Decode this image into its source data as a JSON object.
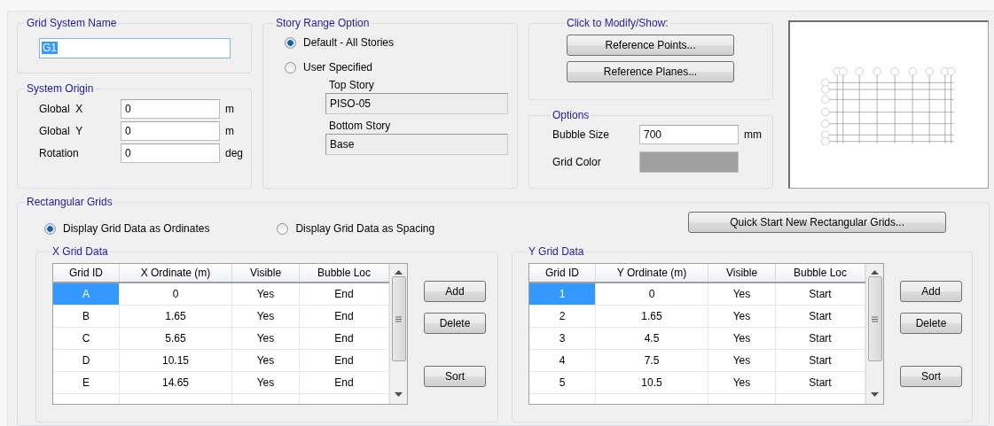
{
  "grid_system_name": {
    "title": "Grid System Name",
    "value": "G1"
  },
  "system_origin": {
    "title": "System Origin",
    "fields": [
      {
        "label": "Global  X",
        "value": "0",
        "unit": "m"
      },
      {
        "label": "Global  Y",
        "value": "0",
        "unit": "m"
      },
      {
        "label": "Rotation",
        "value": "0",
        "unit": "deg"
      }
    ]
  },
  "story_range_option": {
    "title": "Story Range Option",
    "options": [
      {
        "label": "Default - All Stories",
        "selected": true
      },
      {
        "label": "User Specified",
        "selected": false
      }
    ],
    "top_story": {
      "label": "Top Story",
      "value": "PISO-05"
    },
    "bottom_story": {
      "label": "Bottom Story",
      "value": "Base"
    }
  },
  "click_to_modify": {
    "title": "Click to Modify/Show:",
    "buttons": [
      "Reference Points...",
      "Reference Planes..."
    ]
  },
  "options": {
    "title": "Options",
    "bubble_size": {
      "label": "Bubble Size",
      "value": "700",
      "unit": "mm"
    },
    "grid_color": {
      "label": "Grid Color",
      "color": "#a0a0a0"
    }
  },
  "rectangular_grids": {
    "title": "Rectangular Grids",
    "display_options": [
      {
        "label": "Display Grid Data as Ordinates",
        "selected": true
      },
      {
        "label": "Display Grid Data as Spacing",
        "selected": false
      }
    ],
    "quick_start_button": "Quick Start New Rectangular Grids...",
    "grids": [
      {
        "title": "X Grid Data",
        "columns": [
          "Grid ID",
          "X Ordinate (m)",
          "Visible",
          "Bubble Loc"
        ],
        "rows": [
          {
            "cells": [
              "A",
              "0",
              "Yes",
              "End"
            ],
            "selected": true
          },
          {
            "cells": [
              "B",
              "1.65",
              "Yes",
              "End"
            ],
            "selected": false
          },
          {
            "cells": [
              "C",
              "5.65",
              "Yes",
              "End"
            ],
            "selected": false
          },
          {
            "cells": [
              "D",
              "10.15",
              "Yes",
              "End"
            ],
            "selected": false
          },
          {
            "cells": [
              "E",
              "14.65",
              "Yes",
              "End"
            ],
            "selected": false
          }
        ],
        "buttons": [
          "Add",
          "Delete",
          "Sort"
        ]
      },
      {
        "title": "Y Grid Data",
        "columns": [
          "Grid ID",
          "Y Ordinate (m)",
          "Visible",
          "Bubble Loc"
        ],
        "rows": [
          {
            "cells": [
              "1",
              "0",
              "Yes",
              "Start"
            ],
            "selected": true
          },
          {
            "cells": [
              "2",
              "1.65",
              "Yes",
              "Start"
            ],
            "selected": false
          },
          {
            "cells": [
              "3",
              "4.5",
              "Yes",
              "Start"
            ],
            "selected": false
          },
          {
            "cells": [
              "4",
              "7.5",
              "Yes",
              "Start"
            ],
            "selected": false
          },
          {
            "cells": [
              "5",
              "10.5",
              "Yes",
              "Start"
            ],
            "selected": false
          }
        ],
        "buttons": [
          "Add",
          "Delete",
          "Sort"
        ]
      }
    ]
  }
}
